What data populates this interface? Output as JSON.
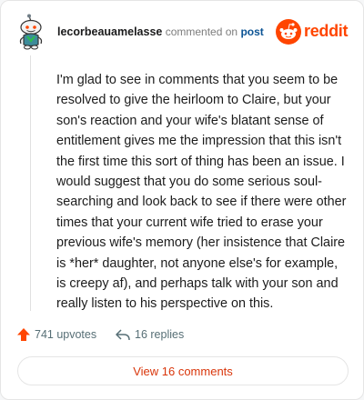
{
  "comment": {
    "username": "lecorbeauamelasse",
    "action_text": "commented on",
    "post_link": "post",
    "body": "I'm glad to see in comments that you seem to be resolved to give the heirloom to Claire, but your son's reaction and your wife's blatant sense of entitlement gives me the impression that this isn't the first time this sort of thing has been an issue. I would suggest that you do some serious soul-searching and look back to see if there were other times that your current wife tried to erase your previous wife's memory (her insistence that Claire is *her* daughter, not anyone else's for example, is creepy af), and perhaps talk with your son and really listen to his perspective on this.",
    "upvotes_label": "741 upvotes",
    "replies_label": "16 replies"
  },
  "brand": {
    "wordmark": "reddit",
    "color": "#ff4500"
  },
  "footer": {
    "view_comments_label": "View 16 comments"
  },
  "icons": {
    "avatar": "snoo-avatar-icon",
    "logo": "reddit-snoo-icon",
    "upvote": "upvote-arrow-icon",
    "reply": "reply-arrow-icon"
  }
}
